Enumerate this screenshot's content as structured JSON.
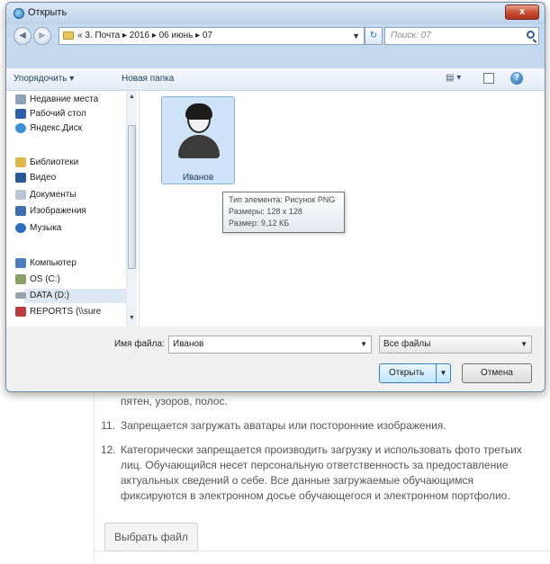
{
  "dialog": {
    "title": "Открыть",
    "close_label": "x",
    "address_parts": "« 3. Почта ▸ 2016 ▸ 06 июнь ▸ 07",
    "search_placeholder": "Поиск: 07",
    "toolbar": {
      "organize": "Упорядочить ▾",
      "new_folder": "Новая папка"
    },
    "nav": {
      "items": [
        {
          "label": "Недавние места",
          "icon": "recent-places-icon",
          "color": "#8fa3b8"
        },
        {
          "label": "Рабочий стол",
          "icon": "desktop-icon",
          "color": "#2e5ea8"
        },
        {
          "label": "Яндекс.Диск",
          "icon": "yandex-disk-icon",
          "color": "#3f8fd6"
        },
        {
          "label": "Библиотеки",
          "icon": "libraries-icon",
          "color": "#e0b84a"
        },
        {
          "label": "Видео",
          "icon": "video-icon",
          "color": "#2a5a96"
        },
        {
          "label": "Документы",
          "icon": "documents-icon",
          "color": "#b8c6d4"
        },
        {
          "label": "Изображения",
          "icon": "images-icon",
          "color": "#3c6eb0"
        },
        {
          "label": "Музыка",
          "icon": "music-icon",
          "color": "#2f6fbf"
        },
        {
          "label": "Компьютер",
          "icon": "computer-icon",
          "color": "#4a7fc0"
        },
        {
          "label": "OS (C:)",
          "icon": "drive-c-icon",
          "color": "#8aa06a"
        },
        {
          "label": "DATA (D:)",
          "icon": "drive-d-icon",
          "color": "#9aa2ac"
        },
        {
          "label": "REPORTS (\\\\sure",
          "icon": "network-drive-icon",
          "color": "#b84040"
        }
      ]
    },
    "file": {
      "name": "Иванов",
      "icon": "user-avatar-icon"
    },
    "tooltip": {
      "type": "Тип элемента: Рисунок PNG",
      "dimensions": "Размеры: 128 x 128",
      "size": "Размер: 9,12 КБ"
    },
    "filename_label": "Имя файла:",
    "filename_value": "Иванов",
    "filter_value": "Все файлы",
    "open_label": "Открыть",
    "cancel_label": "Отмена"
  },
  "page": {
    "partial_line": "пятен, узоров, полос.",
    "items": [
      {
        "num": "11.",
        "text": "Запрещается загружать аватары или посторонние изображения."
      },
      {
        "num": "12.",
        "text": "Категорически запрещается производить загрузку и использовать фото третьих лиц. Обучающийся несет персональную ответственность за предоставление актуальных сведений о себе. Все данные загружаемые обучающимся фиксируются в электронном досье обучающегося и электронном портфолио."
      }
    ],
    "choose_file_label": "Выбрать файл"
  }
}
